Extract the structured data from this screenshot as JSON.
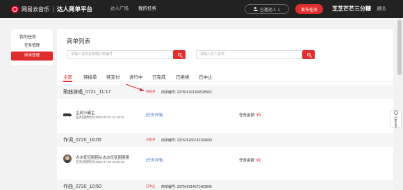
{
  "header": {
    "logo_text": "网易云音乐",
    "platform_name": "达人商单平台",
    "nav": [
      "达人广场",
      "我的任务"
    ],
    "invite_label": "已邀达人 1",
    "publish_label": "发布任务",
    "username": "芝芝芒芒三分糖",
    "logout_label": "退出"
  },
  "sidebar": {
    "heading": "我的任务",
    "items": [
      {
        "label": "任务管理",
        "active": false
      },
      {
        "label": "商单管理",
        "active": true
      }
    ]
  },
  "main": {
    "title": "商单列表",
    "search": {
      "order_placeholder": "请输入任务名称或订单编号",
      "talent_placeholder": "请输入达人名称"
    },
    "tabs": [
      "全部",
      "待接单",
      "待支付",
      "进行中",
      "已完成",
      "已拒绝",
      "已中止"
    ],
    "active_tab": "全部",
    "orders": [
      {
        "title": "歌曲演唱_0721_11:17",
        "status": "待接单",
        "order_no": "商单编号: 337816161360535552",
        "talent_name": "尘封小霸主",
        "created": "任务创建时间 2022-07-21 11:18:11",
        "task_link": "[任务详情]",
        "amount_label": "任务金额:",
        "amount": "¥3",
        "avatar": "car-icon"
      },
      {
        "title": "作词_0720_16:05",
        "status": "已拒单",
        "order_no": "商单编号: 337626266742169600",
        "talent_name": "忐忐怔怔困困从忐忐怔怔困困困",
        "created": "任务创建时间 2022-07-20 16:06:15",
        "task_link": "[任务详情]",
        "amount_label": "任务金额:",
        "amount": "¥2",
        "avatar": "face-icon"
      },
      {
        "title": "作曲_0720_10:50",
        "status": "已中止",
        "order_no": "商单编号: 337546914071453696"
      }
    ]
  },
  "help_float": "问题反馈",
  "colors": {
    "accent": "#e02d2d",
    "header_bg": "#222222",
    "link": "#4a7fd0"
  }
}
